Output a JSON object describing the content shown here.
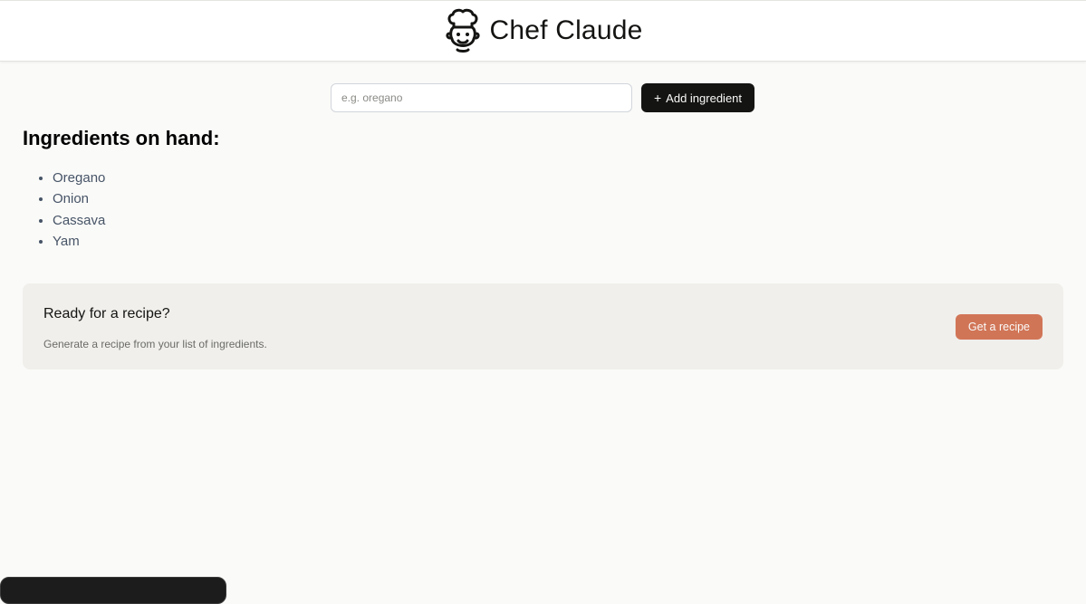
{
  "header": {
    "logo_icon": "chef-icon",
    "title": "Chef Claude"
  },
  "form": {
    "placeholder": "e.g. oregano",
    "value": "",
    "add_icon": "+",
    "add_label": "Add ingredient"
  },
  "ingredients": {
    "heading": "Ingredients on hand:",
    "items": [
      "Oregano",
      "Onion",
      "Cassava",
      "Yam"
    ]
  },
  "recipe_cta": {
    "heading": "Ready for a recipe?",
    "subtext": "Generate a recipe from your list of ingredients.",
    "button_label": "Get a recipe"
  },
  "colors": {
    "page_background": "#fafaf8",
    "add_button": "#141413",
    "cta_background": "#f0efeb",
    "accent": "#d17557"
  }
}
